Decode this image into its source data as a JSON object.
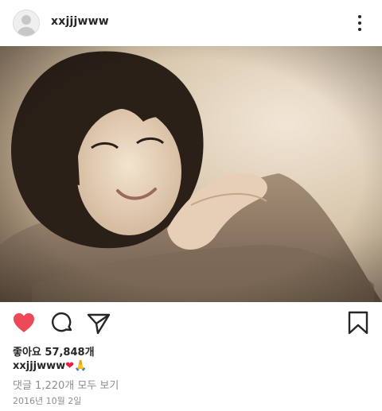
{
  "post": {
    "username": "xxjjjwww",
    "likes_text": "좋아요 57,848개",
    "caption_user": "xxjjjwww",
    "caption_emoji_heart": "❤",
    "caption_emoji_hands": "🙏",
    "comments_text": "댓글 1,220개 모두 보기",
    "date_text": "2016년 10월 2일"
  },
  "icons": {
    "avatar": "default-avatar-icon",
    "more": "more-options-icon",
    "like": "heart-filled-icon",
    "comment": "comment-bubble-icon",
    "share": "paper-plane-icon",
    "save": "bookmark-icon"
  },
  "colors": {
    "like_red": "#ed4956",
    "text": "#262626",
    "muted": "#8e8e8e"
  }
}
